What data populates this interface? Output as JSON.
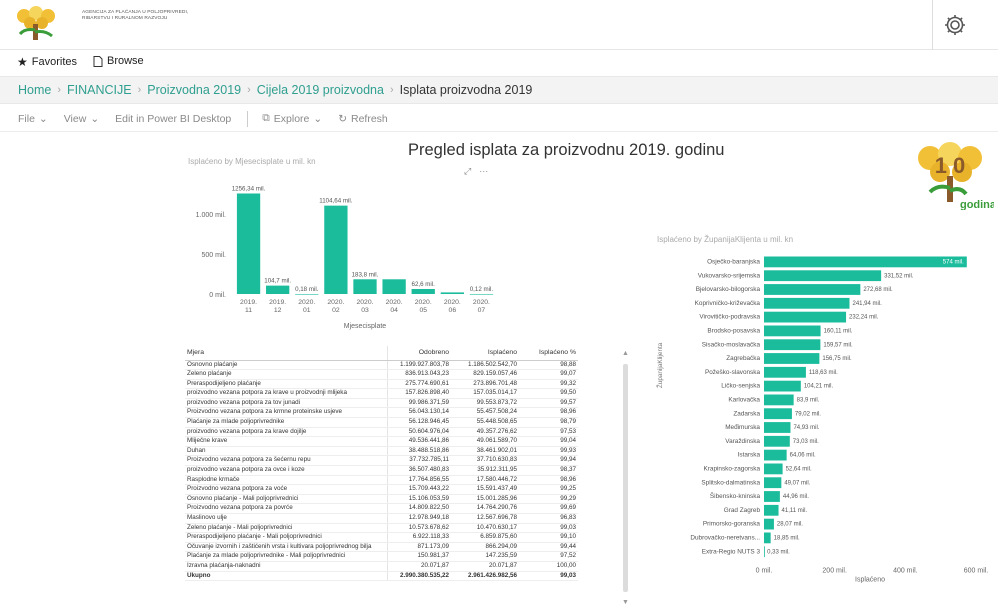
{
  "header": {
    "agency_line1": "AGENCIJA ZA PLAĆANJA U POLJOPRIVREDI,",
    "agency_line2": "RIBARSTVU I RURALNOM RAZVOJU",
    "logo_icon": "apprrr-logo-icon",
    "settings_icon": "gear-icon"
  },
  "nav": {
    "favorites": "Favorites",
    "browse": "Browse"
  },
  "breadcrumb": [
    "Home",
    "FINANCIJE",
    "Proizvodna 2019",
    "Cijela 2019 proizvodna",
    "Isplata proizvodna 2019"
  ],
  "toolbar": {
    "file": "File",
    "view": "View",
    "edit": "Edit in Power BI Desktop",
    "explore": "Explore",
    "refresh": "Refresh"
  },
  "report": {
    "title": "Pregled isplata za proizvodnu 2019. godinu",
    "anniv_number": "1 0",
    "anniv_label": "godina"
  },
  "chart_data": [
    {
      "type": "bar",
      "title": "Isplaćeno by Mjesecisplate u mil. kn",
      "xlabel": "Mjesecisplate",
      "ylabel": "",
      "categories": [
        "2019. 11",
        "2019. 12",
        "2020. 01",
        "2020. 02",
        "2020. 03",
        "2020. 04",
        "2020. 05",
        "2020. 06",
        "2020. 07"
      ],
      "values": [
        1256.34,
        104.7,
        0.18,
        1104.64,
        183.8,
        183.8,
        62.6,
        20.0,
        0.12
      ],
      "data_labels": [
        "1256,34 mil.",
        "104,7 mil.",
        "0,18 mil.",
        "1104,64 mil.",
        "183,8 mil.",
        "",
        "62,6 mil.",
        "",
        "0,12 mil."
      ],
      "yticks": [
        "1.000 mil.",
        "500 mil.",
        "0 mil."
      ],
      "ylim": [
        0,
        1300
      ],
      "color": "#1abc9c"
    },
    {
      "type": "bar",
      "orientation": "horizontal",
      "title": "Isplaćeno by ŽupanijaKlijenta u mil. kn",
      "xlabel": "Isplaćeno",
      "ylabel": "ŽupanijaKlijenta",
      "categories": [
        "Osječko-baranjska",
        "Vukovarsko-srijemska",
        "Bjelovarsko-bilogorska",
        "Koprivničko-križevačka",
        "Virovitičko-podravska",
        "Brodsko-posavska",
        "Sisačko-moslavačka",
        "Zagrebačka",
        "Požeško-slavonska",
        "Ličko-senjska",
        "Karlovačka",
        "Zadarska",
        "Međimurska",
        "Varaždinska",
        "Istarska",
        "Krapinsko-zagorska",
        "Splitsko-dalmatinska",
        "Šibensko-kninska",
        "Grad Zagreb",
        "Primorsko-goranska",
        "Dubrovačko-neretvans...",
        "Extra-Regio NUTS 3"
      ],
      "values": [
        574,
        331.52,
        272.68,
        241.94,
        232.24,
        160.11,
        159.57,
        156.75,
        118.63,
        104.21,
        83.9,
        79.02,
        74.93,
        73.03,
        64.06,
        52.64,
        49.07,
        44.96,
        41.11,
        28.07,
        18.85,
        0.33
      ],
      "data_labels": [
        "574 mil.",
        "331,52 mil.",
        "272,68 mil.",
        "241,94 mil.",
        "232,24 mil.",
        "160,11 mil.",
        "159,57 mil.",
        "156,75 mil.",
        "118,63 mil.",
        "104,21 mil.",
        "83,9 mil.",
        "79,02 mil.",
        "74,93 mil.",
        "73,03 mil.",
        "64,06 mil.",
        "52,64 mil.",
        "49,07 mil.",
        "44,96 mil.",
        "41,11 mil.",
        "28,07 mil.",
        "18,85 mil.",
        "0,33 mil."
      ],
      "xticks": [
        "0 mil.",
        "200 mil.",
        "400 mil.",
        "600 mil."
      ],
      "xlim": [
        0,
        600
      ],
      "color": "#1abc9c"
    }
  ],
  "table": {
    "headers": [
      "Mjera",
      "Odobreno",
      "Isplaćeno",
      "Isplaćeno %"
    ],
    "rows": [
      [
        "Osnovno plaćanje",
        "1.199.927.803,78",
        "1.186.502.542,70",
        "98,88"
      ],
      [
        "Zeleno plaćanje",
        "836.913.043,23",
        "829.159.057,46",
        "99,07"
      ],
      [
        "Preraspodijeljeno plaćanje",
        "275.774.690,61",
        "273.896.701,48",
        "99,32"
      ],
      [
        "proizvodno vezana potpora za krave u proizvodnji mlijeka",
        "157.826.898,40",
        "157.035.014,17",
        "99,50"
      ],
      [
        "proizvodno vezana potpora za tov junadi",
        "99.986.371,59",
        "99.553.873,72",
        "99,57"
      ],
      [
        "Proizvodno vezana potpora za krmne proteinske usjeve",
        "56.043.130,14",
        "55.457.508,24",
        "98,96"
      ],
      [
        "Plaćanje za mlade poljoprivrednike",
        "56.128.946,45",
        "55.448.508,65",
        "98,79"
      ],
      [
        "proizvodno vezana potpora za krave dojilje",
        "50.604.976,04",
        "49.357.276,62",
        "97,53"
      ],
      [
        "Mliječne krave",
        "49.536.441,86",
        "49.061.589,70",
        "99,04"
      ],
      [
        "Duhan",
        "38.488.518,86",
        "38.461.902,01",
        "99,93"
      ],
      [
        "Proizvodno vezana potpora za šećernu repu",
        "37.732.785,11",
        "37.710.630,83",
        "99,94"
      ],
      [
        "proizvodno vezana potpora za ovce i koze",
        "36.507.480,83",
        "35.912.311,95",
        "98,37"
      ],
      [
        "Rasplodne krmače",
        "17.764.856,55",
        "17.580.446,72",
        "98,96"
      ],
      [
        "Proizvodno vezana potpora za voće",
        "15.709.443,22",
        "15.591.437,49",
        "99,25"
      ],
      [
        "Osnovno plaćanje - Mali poljoprivrednici",
        "15.106.053,59",
        "15.001.285,96",
        "99,29"
      ],
      [
        "Proizvodno vezana potpora za povrće",
        "14.809.822,50",
        "14.764.290,76",
        "99,69"
      ],
      [
        "Maslinovo ulje",
        "12.978.949,18",
        "12.567.696,78",
        "96,83"
      ],
      [
        "Zeleno plaćanje - Mali poljoprivrednici",
        "10.573.678,62",
        "10.470.630,17",
        "99,03"
      ],
      [
        "Preraspodijeljeno plaćanje - Mali poljoprivrednici",
        "6.922.118,33",
        "6.859.875,60",
        "99,10"
      ],
      [
        "Očuvanje izvornih i zaštićenih vrsta i kultivara poljoprivrednog bilja",
        "871.173,09",
        "866.294,09",
        "99,44"
      ],
      [
        "Plaćanje za mlade poljoprivrednike - Mali poljoprivrednici",
        "150.981,37",
        "147.235,59",
        "97,52"
      ],
      [
        "Izravna plaćanja-naknadni",
        "20.071,87",
        "20.071,87",
        "100,00"
      ]
    ],
    "total": [
      "Ukupno",
      "2.990.380.535,22",
      "2.961.426.982,56",
      "99,03"
    ]
  }
}
